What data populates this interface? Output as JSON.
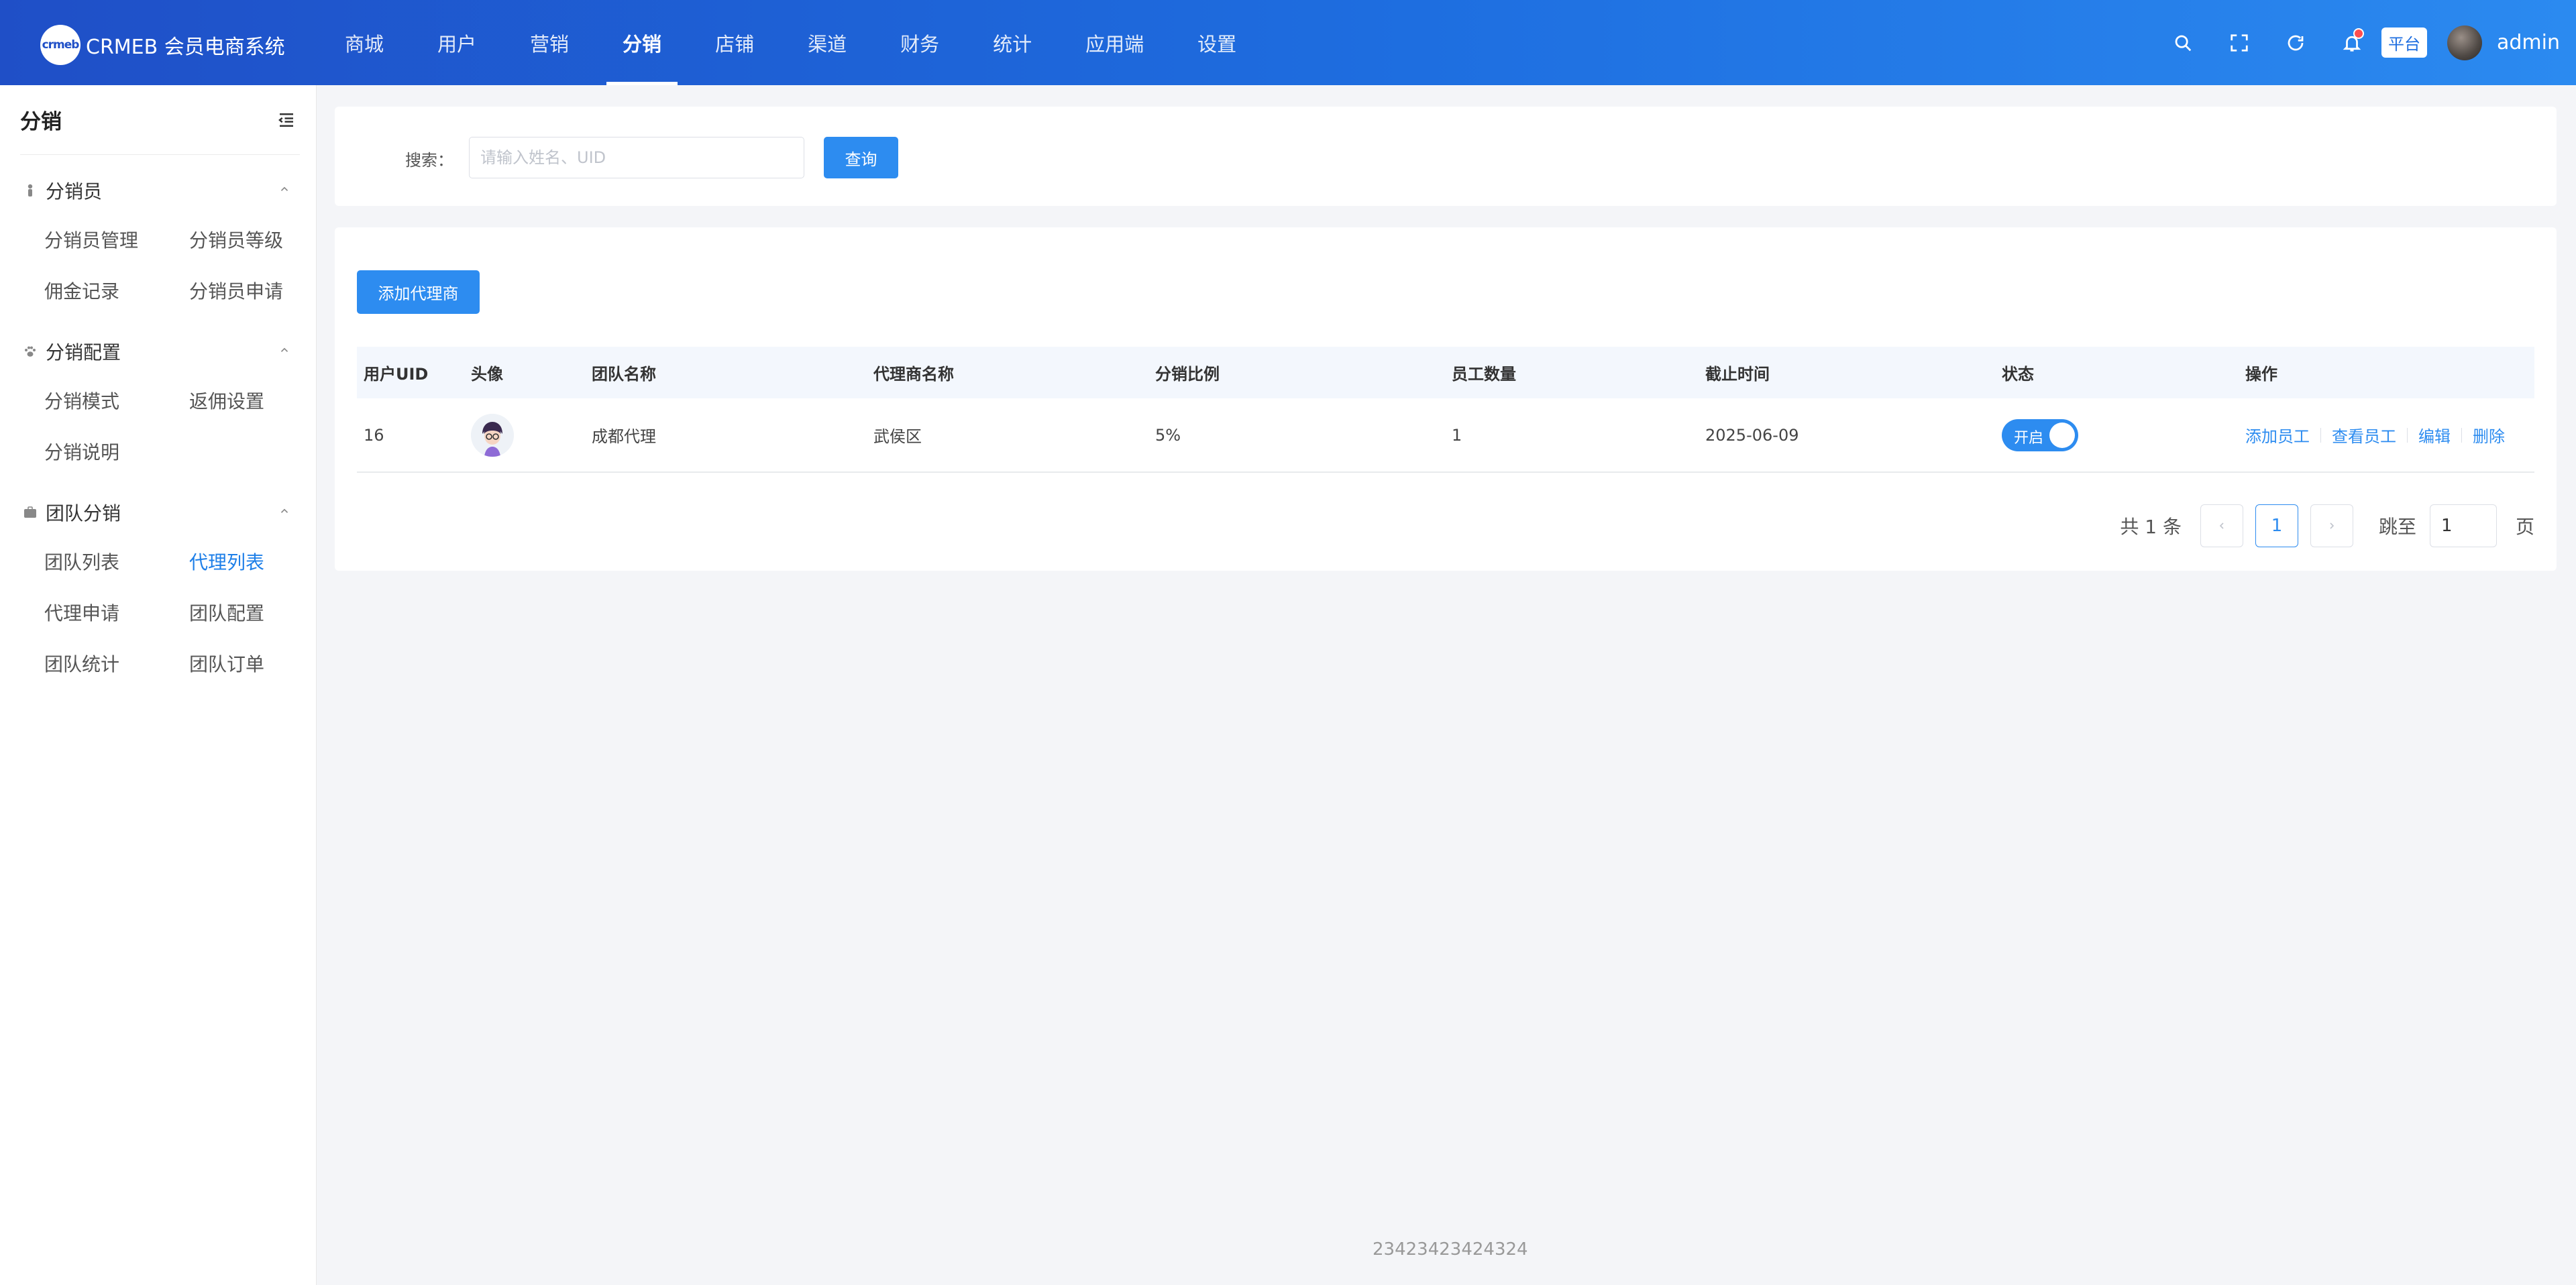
{
  "header": {
    "logo_badge": "crmeb",
    "logo_text": "CRMEB 会员电商系统",
    "nav": [
      "商城",
      "用户",
      "营销",
      "分销",
      "店铺",
      "渠道",
      "财务",
      "统计",
      "应用端",
      "设置"
    ],
    "active_nav": "分销",
    "platform_tag": "平台",
    "username": "admin",
    "icons": [
      "search-icon",
      "fullscreen-icon",
      "refresh-icon",
      "bell-icon"
    ]
  },
  "sidebar": {
    "title": "分销",
    "groups": [
      {
        "label": "分销员",
        "icon": "person-icon",
        "items": [
          "分销员管理",
          "分销员等级",
          "佣金记录",
          "分销员申请"
        ]
      },
      {
        "label": "分销配置",
        "icon": "paw-icon",
        "items": [
          "分销模式",
          "返佣设置",
          "分销说明"
        ]
      },
      {
        "label": "团队分销",
        "icon": "briefcase-icon",
        "items": [
          "团队列表",
          "代理列表",
          "代理申请",
          "团队配置",
          "团队统计",
          "团队订单"
        ]
      }
    ],
    "active_item": "代理列表"
  },
  "search": {
    "label": "搜索：",
    "placeholder": "请输入姓名、UID",
    "value": "",
    "button": "查询"
  },
  "actions": {
    "add_agent": "添加代理商"
  },
  "table": {
    "columns": [
      "用户UID",
      "头像",
      "团队名称",
      "代理商名称",
      "分销比例",
      "员工数量",
      "截止时间",
      "状态",
      "操作"
    ],
    "rows": [
      {
        "uid": "16",
        "team_name": "成都代理",
        "agent_name": "武侯区",
        "ratio": "5%",
        "staff_count": "1",
        "deadline": "2025-06-09",
        "status_label": "开启",
        "status_on": true,
        "ops": [
          "添加员工",
          "查看员工",
          "编辑",
          "删除"
        ]
      }
    ]
  },
  "pagination": {
    "total": "共 1 条",
    "current": "1",
    "jump_label": "跳至",
    "jump_value": "1",
    "unit": "页"
  },
  "footer": "23423423424324",
  "colors": {
    "primary": "#2d8cf0",
    "header_start": "#1f4fc7",
    "header_end": "#2b8af0",
    "notice_dot": "#ff4d4f"
  }
}
